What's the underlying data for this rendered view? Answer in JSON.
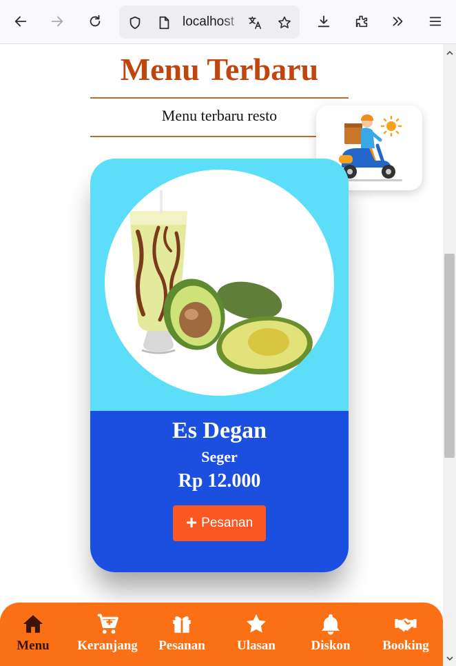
{
  "browser": {
    "url": "localhost",
    "icons": [
      "back-icon",
      "forward-icon",
      "reload-icon",
      "shield-icon",
      "page-icon",
      "translate-icon",
      "star-icon",
      "download-icon",
      "extensions-icon",
      "overflow-icon",
      "menu-icon"
    ]
  },
  "header": {
    "title": "Menu Terbaru",
    "subtitle": "Menu terbaru resto"
  },
  "menu_item": {
    "name": "Es Degan",
    "description": "Seger",
    "price": "Rp 12.000",
    "order_button": "Pesanan"
  },
  "bottom_nav": {
    "items": [
      {
        "label": "Menu",
        "icon": "home-icon",
        "active": true
      },
      {
        "label": "Keranjang",
        "icon": "cart-icon",
        "active": false
      },
      {
        "label": "Pesanan",
        "icon": "gift-icon",
        "active": false
      },
      {
        "label": "Ulasan",
        "icon": "star-icon",
        "active": false
      },
      {
        "label": "Diskon",
        "icon": "bell-icon",
        "active": false
      },
      {
        "label": "Booking",
        "icon": "handshake-icon",
        "active": false
      }
    ]
  },
  "colors": {
    "title": "#c0460f",
    "card_top": "#5cddf8",
    "card_bottom": "#1a4fe0",
    "order_button": "#fb5722",
    "nav_bg": "#fb7014",
    "nav_active": "#3a1408"
  }
}
